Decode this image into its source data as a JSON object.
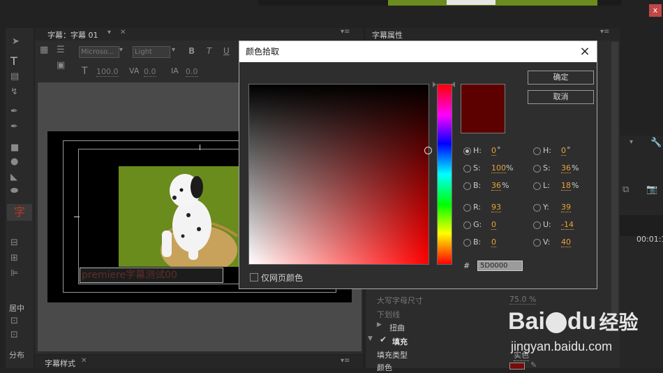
{
  "close_symbol": "×",
  "close_symbol_small": "x",
  "left_panel": {
    "tab_title": "字幕：字幕 01",
    "font_family": "Microso...",
    "font_style": "Light",
    "bold": "B",
    "italic": "T",
    "underline": "U",
    "text_t": "T",
    "size_value": "100.0",
    "kerning_value": "0.0",
    "leading_value": "0.0",
    "side_labels": [
      "居中",
      "分布"
    ],
    "side_red_glyph": "字"
  },
  "subtitle_text": "premiere字幕测试00",
  "bottom_tab": "字幕样式",
  "right_panel": {
    "tab_title": "字幕属性",
    "rows": [
      {
        "label": "大写字母尺寸",
        "value": "75.0 %"
      },
      {
        "label": "下划线",
        "value": ""
      },
      {
        "label": "扭曲",
        "value": ""
      },
      {
        "label": "填充",
        "value": ""
      },
      {
        "label": "填充类型",
        "value": "实色"
      },
      {
        "label": "颜色",
        "value": ""
      }
    ]
  },
  "far_right": {
    "timecode": "00:01:1"
  },
  "watermark": {
    "brand": "Bai",
    "brand_icon": "paw-icon",
    "brand_tail": "du",
    "brand_cn": "经验",
    "url": "jingyan.baidu.com"
  },
  "dialog": {
    "title": "颜色拾取",
    "ok": "确定",
    "cancel": "取消",
    "selected_color": "#5D0000",
    "hsb": {
      "h_label": "H:",
      "h": "0",
      "h_unit": "°",
      "s_label": "S:",
      "s": "100",
      "s_unit": "%",
      "b_label": "B:",
      "b": "36",
      "b_unit": "%"
    },
    "hsl": {
      "h_label": "H:",
      "h": "0",
      "h_unit": "°",
      "s_label": "S:",
      "s": "36",
      "s_unit": "%",
      "l_label": "L:",
      "l": "18",
      "l_unit": "%"
    },
    "rgb": {
      "r_label": "R:",
      "r": "93",
      "g_label": "G:",
      "g": "0",
      "b_label": "B:",
      "b": "0"
    },
    "yuv": {
      "y_label": "Y:",
      "y": "39",
      "u_label": "U:",
      "u": "-14",
      "v_label": "V:",
      "v": "40"
    },
    "hex_label": "#",
    "hex": "5D0000",
    "web_only_label": "仅网页颜色"
  }
}
